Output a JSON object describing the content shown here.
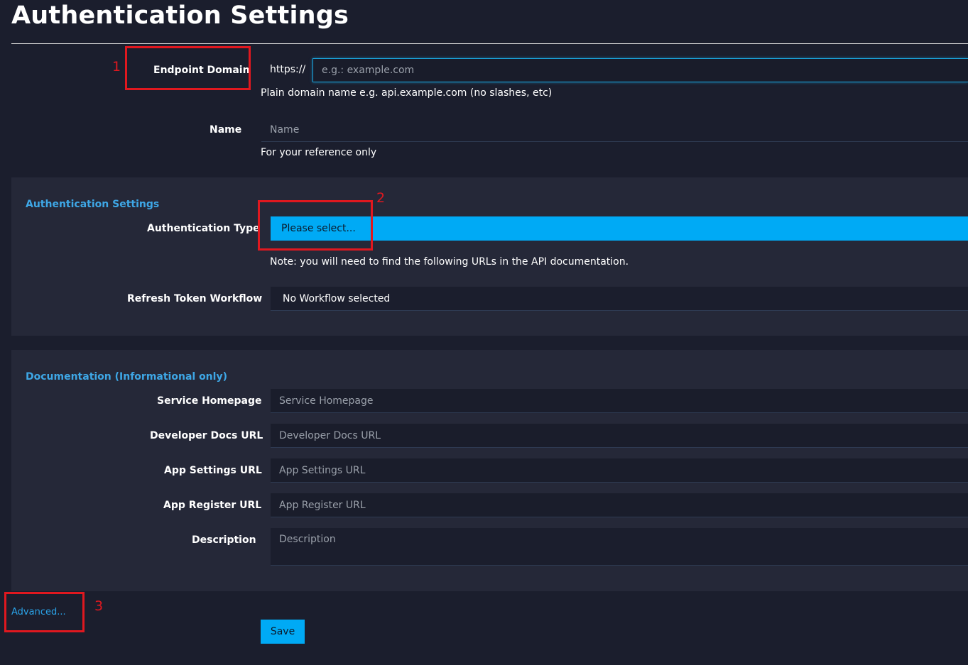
{
  "page": {
    "title": "Authentication Settings"
  },
  "endpoint": {
    "label": "Endpoint Domain",
    "prefix": "https://",
    "placeholder": "e.g.: example.com",
    "help": "Plain domain name e.g. api.example.com (no slashes, etc)"
  },
  "name_field": {
    "label": "Name",
    "placeholder": "Name",
    "help": "For your reference only"
  },
  "auth_section": {
    "title": "Authentication Settings",
    "auth_type_label": "Authentication Type",
    "auth_type_value": "Please select...",
    "note": "Note: you will need to find the following URLs in the API documentation.",
    "refresh_label": "Refresh Token Workflow",
    "refresh_value": "No Workflow selected"
  },
  "doc_section": {
    "title": "Documentation (Informational only)",
    "fields": [
      {
        "label": "Service Homepage",
        "placeholder": "Service Homepage"
      },
      {
        "label": "Developer Docs URL",
        "placeholder": "Developer Docs URL"
      },
      {
        "label": "App Settings URL",
        "placeholder": "App Settings URL"
      },
      {
        "label": "App Register URL",
        "placeholder": "App Register URL"
      },
      {
        "label": "Description",
        "placeholder": "Description"
      }
    ]
  },
  "footer": {
    "advanced_label": "Advanced...",
    "save_label": "Save"
  },
  "annotations": [
    "1",
    "2",
    "3"
  ],
  "colors": {
    "background": "#1b1e2d",
    "panel": "#252838",
    "accent": "#00aaf5",
    "link": "#3ea7e6",
    "annotation": "#e0181f"
  }
}
